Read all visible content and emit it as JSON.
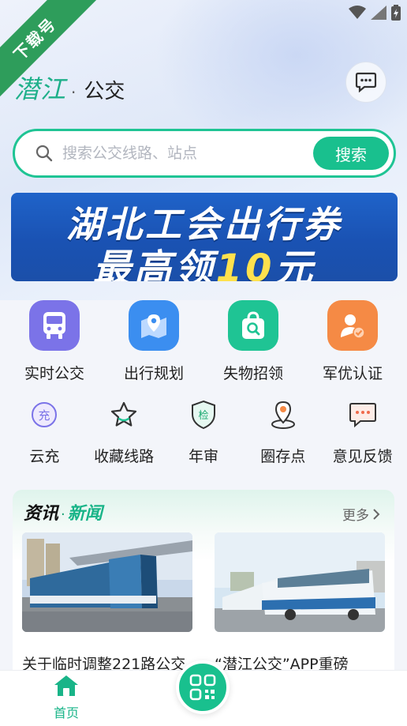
{
  "ribbon": {
    "label": "下载号",
    "color": "#2e9d5b"
  },
  "status_bar": {
    "icons": [
      "wifi-icon",
      "signal-icon",
      "battery-icon"
    ]
  },
  "header": {
    "logo_text": "潜江",
    "logo_dot": "·",
    "app_name": "公交",
    "message_icon": "chat-dots-icon"
  },
  "search": {
    "placeholder": "搜索公交线路、站点",
    "button_label": "搜索",
    "accent": "#19c08e"
  },
  "banner": {
    "line1": "湖北工会出行券",
    "line2_prefix": "最高领",
    "line2_highlight": "10",
    "line2_suffix": "元"
  },
  "main_services": [
    {
      "label": "实时公交",
      "icon": "bus-icon",
      "color": "#7b73e8"
    },
    {
      "label": "出行规划",
      "icon": "map-pin-icon",
      "color": "#3b8ef0"
    },
    {
      "label": "失物招领",
      "icon": "bag-search-icon",
      "color": "#1fc494"
    },
    {
      "label": "军优认证",
      "icon": "soldier-badge-icon",
      "color": "#f58a45"
    }
  ],
  "sub_services": [
    {
      "label": "云充",
      "icon": "recharge-icon"
    },
    {
      "label": "收藏线路",
      "icon": "star-icon"
    },
    {
      "label": "年审",
      "icon": "shield-check-icon"
    },
    {
      "label": "圈存点",
      "icon": "location-icon"
    },
    {
      "label": "意见反馈",
      "icon": "feedback-icon"
    }
  ],
  "news": {
    "heading_1": "资讯",
    "heading_sep": "·",
    "heading_2": "新闻",
    "more_label": "更多",
    "items": [
      {
        "title": "关于临时调整221路公交"
      },
      {
        "title": "“潜江公交”APP重磅"
      }
    ]
  },
  "tabbar": {
    "home_label": "首页",
    "scan_icon": "qr-scan-icon"
  }
}
